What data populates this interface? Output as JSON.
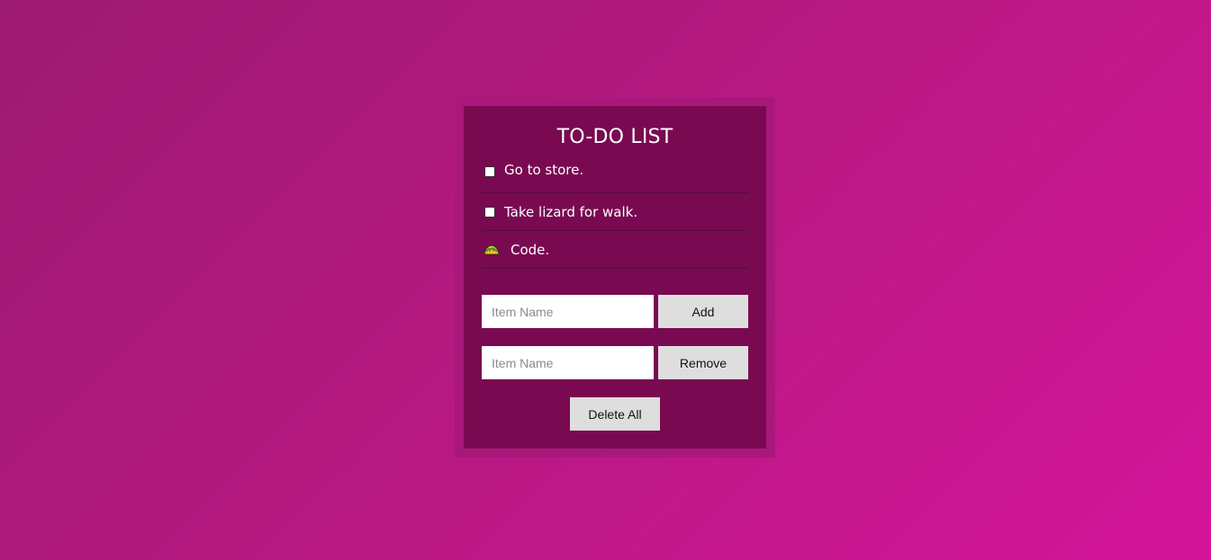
{
  "app": {
    "title": "TO-DO LIST"
  },
  "todos": [
    {
      "label": "Go to store.",
      "marker": "checkbox"
    },
    {
      "label": "Take lizard for walk.",
      "marker": "checkbox"
    },
    {
      "label": "Code.",
      "marker": "taco-icon"
    }
  ],
  "add_form": {
    "placeholder": "Item Name",
    "value": "",
    "button_label": "Add"
  },
  "remove_form": {
    "placeholder": "Item Name",
    "value": "",
    "button_label": "Remove"
  },
  "delete_all_label": "Delete All",
  "colors": {
    "background_start": "#9d1a72",
    "background_end": "#d4159a",
    "frame": "#a8187a",
    "card": "#790a52",
    "button": "#dedede"
  }
}
